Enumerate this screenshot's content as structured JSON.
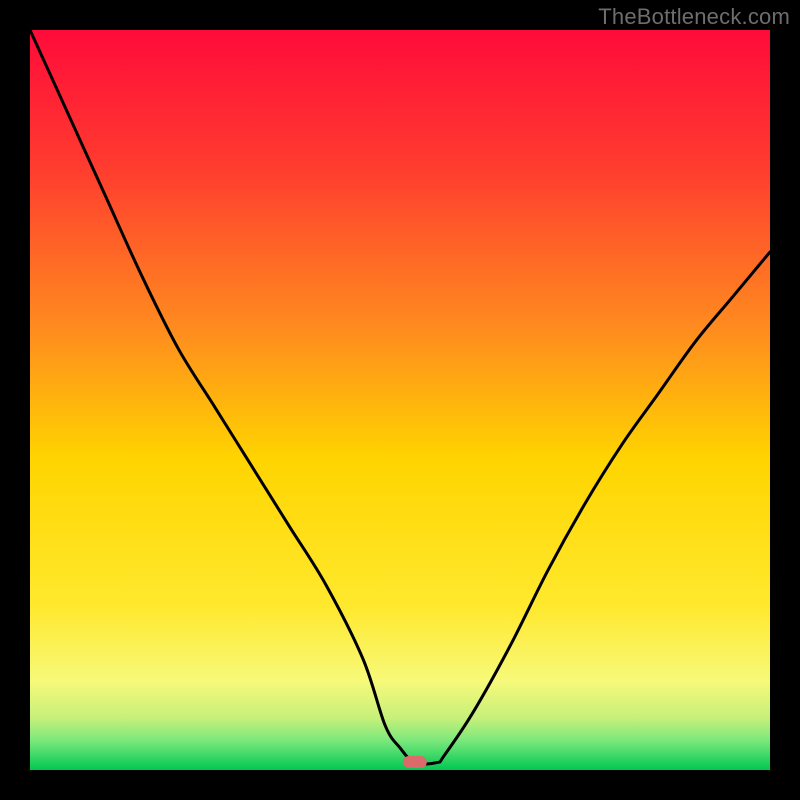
{
  "watermark": "TheBottleneck.com",
  "chart_data": {
    "type": "line",
    "title": "",
    "xlabel": "",
    "ylabel": "",
    "xlim": [
      0,
      100
    ],
    "ylim": [
      0,
      100
    ],
    "x": [
      0,
      5,
      10,
      15,
      20,
      25,
      30,
      35,
      40,
      45,
      48,
      50,
      52,
      55,
      56,
      60,
      65,
      70,
      75,
      80,
      85,
      90,
      95,
      100
    ],
    "values": [
      100,
      89,
      78,
      67,
      57,
      49,
      41,
      33,
      25,
      15,
      6,
      3,
      1,
      1,
      2,
      8,
      17,
      27,
      36,
      44,
      51,
      58,
      64,
      70
    ],
    "note": "Bottleneck curve with minimum near x≈52. Values are estimated percentages (0=bottom green, 100=top red)."
  },
  "gradient_colors": {
    "top": "#ff0b3a",
    "mid_upper": "#ff5a2a",
    "mid": "#ffd400",
    "lower_yellow": "#f7f97a",
    "green_light": "#7ce87c",
    "green": "#00c853"
  },
  "marker": {
    "x_pct": 52,
    "color": "#db6a6a"
  }
}
